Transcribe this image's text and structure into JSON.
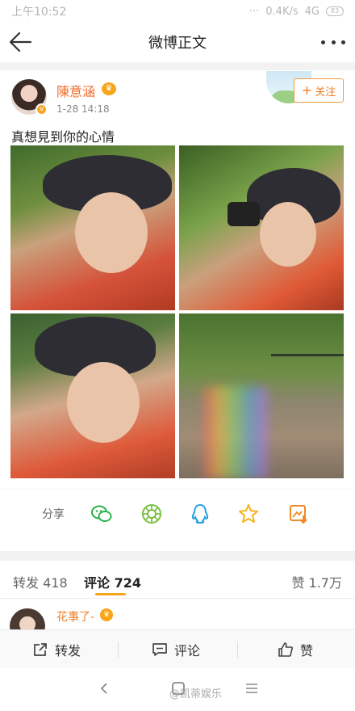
{
  "status_bar": {
    "time": "上午10:52",
    "dots": "···",
    "speed": "0.4K/s",
    "network": "4G",
    "battery": "83"
  },
  "nav": {
    "title": "微博正文"
  },
  "post": {
    "username": "陳意涵",
    "time": "1-28 14:18",
    "text": "真想見到你的心情",
    "follow_label": "关注",
    "photos": [
      "photo-selfie-red-jacket",
      "photo-holding-camera",
      "photo-selfie-hat",
      "photo-stone-stairs-rainbow"
    ]
  },
  "share": {
    "label": "分享",
    "icons": [
      "wechat-icon",
      "moments-icon",
      "qq-icon",
      "qzone-icon",
      "save-image-icon"
    ]
  },
  "tabs": {
    "repost": "转发 418",
    "comments": "评论 724",
    "likes": "赞 1.7万"
  },
  "comment": {
    "username": "花事了-"
  },
  "actions": {
    "repost": "转发",
    "comment": "评论",
    "like": "赞"
  },
  "watermark": "@凯蒂娱乐",
  "colors": {
    "accent": "#f07c22",
    "tab_underline": "#f5a623"
  }
}
